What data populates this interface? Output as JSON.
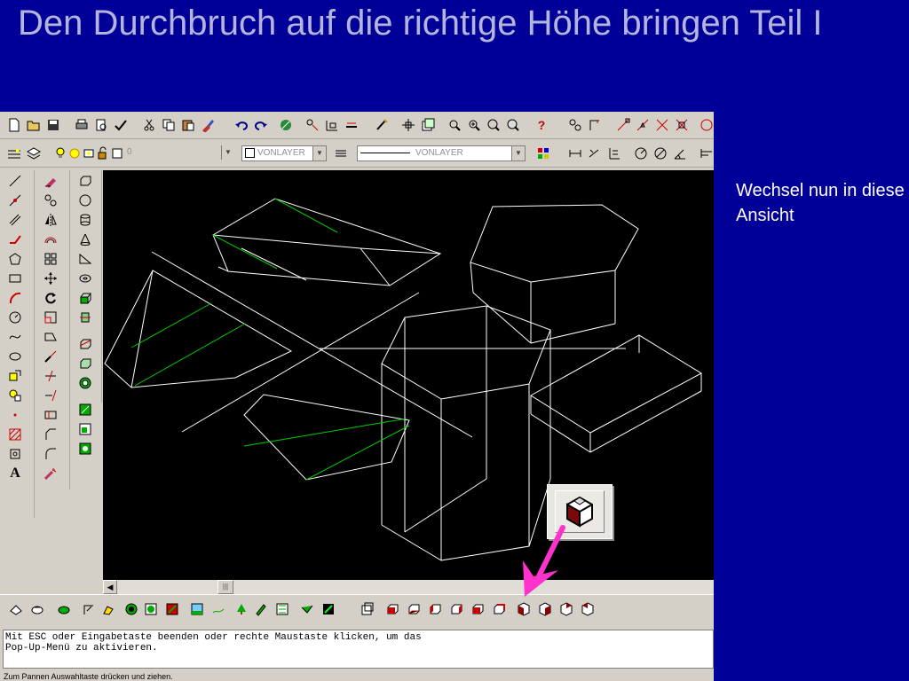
{
  "slide": {
    "title": "Den Durchbruch auf die richtige Höhe bringen Teil I",
    "note": "Wechsel nun in diese Ansicht"
  },
  "properties_bar": {
    "layer_value": "0",
    "color_value": "VONLAYER",
    "linetype_value": "VONLAYER"
  },
  "command_window": {
    "line1": "Mit ESC oder Eingabetaste beenden oder rechte Maustaste klicken, um das",
    "line2": "Pop-Up-Menü zu aktivieren."
  },
  "status": {
    "text": "Zum Pannen Auswahltaste drücken und ziehen."
  },
  "highlighted_tool": {
    "icon": "view-cube-icon"
  },
  "colors": {
    "slide_background": "#000099",
    "title_text": "#b4b4dc",
    "wireframe": "#ffffff",
    "hatch": "#00cc00",
    "annotation_arrow": "#ff33cc"
  }
}
